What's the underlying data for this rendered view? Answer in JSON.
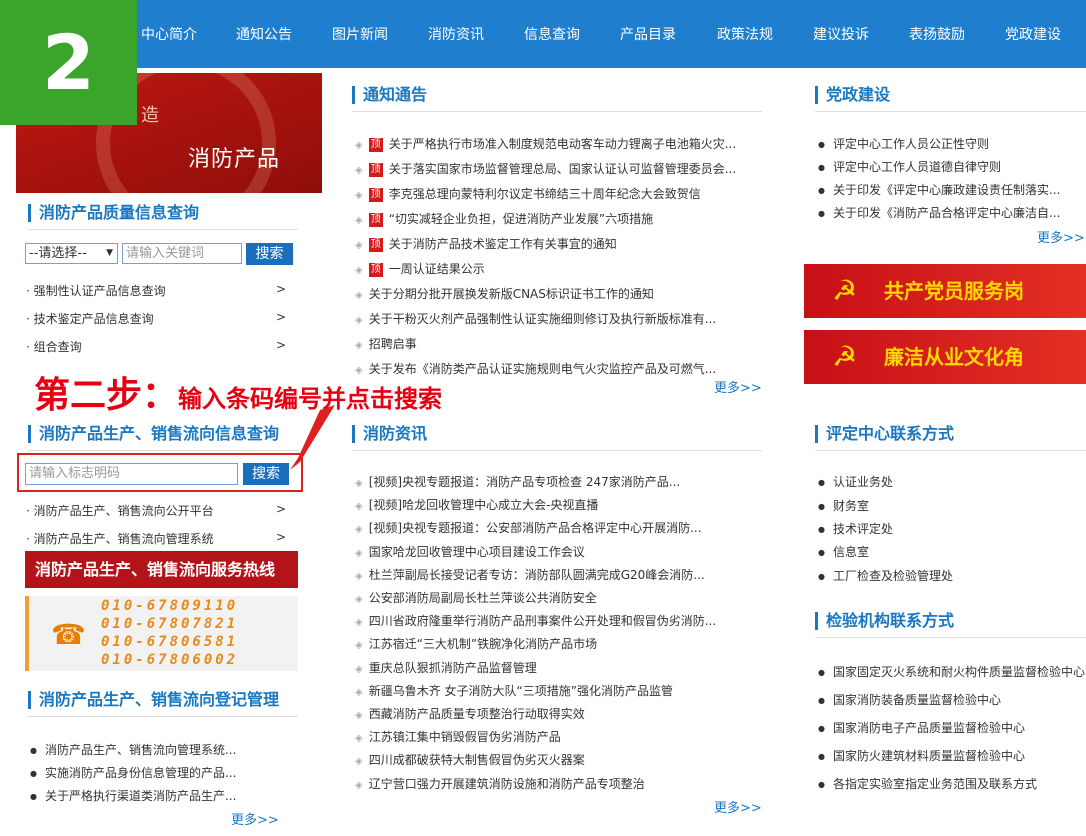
{
  "nav": [
    "中心简介",
    "通知公告",
    "图片新闻",
    "消防资讯",
    "信息查询",
    "产品目录",
    "政策法规",
    "建议投诉",
    "表扬鼓励",
    "党政建设"
  ],
  "step_badge": "2",
  "banner": {
    "text": "消防产品",
    "partial": "造"
  },
  "quality": {
    "title": "消防产品质量信息查询",
    "select_value": "--请选择--",
    "keyword_placeholder": "请输入关键词",
    "search_label": "搜索",
    "links": [
      "强制性认证产品信息查询",
      "技术鉴定产品信息查询",
      "组合查询"
    ]
  },
  "step2": {
    "big": "第二步：",
    "small": "输入条码编号并点击搜索"
  },
  "flow": {
    "title": "消防产品生产、销售流向信息查询",
    "input_placeholder": "请输入标志明码",
    "search_label": "搜索",
    "links": [
      "消防产品生产、销售流向公开平台",
      "消防产品生产、销售流向管理系统"
    ]
  },
  "hotline": {
    "title": "消防产品生产、销售流向服务热线",
    "numbers": [
      "010-67809110",
      "010-67807821",
      "010-67806581",
      "010-67806002"
    ]
  },
  "register": {
    "title": "消防产品生产、销售流向登记管理",
    "items": [
      "消防产品生产、销售流向管理系统...",
      "实施消防产品身份信息管理的产品...",
      "关于严格执行渠道类消防产品生产..."
    ],
    "more": "更多>>"
  },
  "notice": {
    "title": "通知通告",
    "top_label": "顶",
    "items": [
      {
        "text": "关于严格执行市场准入制度规范电动客车动力锂离子电池箱火灾...",
        "top": true
      },
      {
        "text": "关于落实国家市场监督管理总局、国家认证认可监督管理委员会...",
        "top": true
      },
      {
        "text": "李克强总理向蒙特利尔议定书缔结三十周年纪念大会致贺信",
        "top": true
      },
      {
        "text": "“切实减轻企业负担，促进消防产业发展”六项措施",
        "top": true
      },
      {
        "text": "关于消防产品技术鉴定工作有关事宜的通知",
        "top": true
      },
      {
        "text": "一周认证结果公示",
        "top": true
      },
      {
        "text": "关于分期分批开展换发新版CNAS标识证书工作的通知",
        "top": false
      },
      {
        "text": "关于干粉灭火剂产品强制性认证实施细则修订及执行新版标准有...",
        "top": false
      },
      {
        "text": "招聘启事",
        "top": false
      },
      {
        "text": "关于发布《消防类产品认证实施规则电气火灾监控产品及可燃气...",
        "top": false
      }
    ],
    "more": "更多>>"
  },
  "fire_news": {
    "title": "消防资讯",
    "items": [
      "[视频]央视专题报道：消防产品专项检查 247家消防产品...",
      "[视频]哈龙回收管理中心成立大会-央视直播",
      "[视频]央视专题报道：公安部消防产品合格评定中心开展消防...",
      "国家哈龙回收管理中心项目建设工作会议",
      "杜兰萍副局长接受记者专访：消防部队圆满完成G20峰会消防...",
      "公安部消防局副局长杜兰萍谈公共消防安全",
      "四川省政府隆重举行消防产品刑事案件公开处理和假冒伪劣消防...",
      "江苏宿迁“三大机制”铁腕净化消防产品市场",
      "重庆总队狠抓消防产品监督管理",
      "新疆乌鲁木齐 女子消防大队“三项措施”强化消防产品监管",
      "西藏消防产品质量专项整治行动取得实效",
      "江苏镇江集中销毁假冒伪劣消防产品",
      "四川成都破获特大制售假冒伪劣灭火器案",
      "辽宁营口强力开展建筑消防设施和消防产品专项整治"
    ],
    "more": "更多>>"
  },
  "party": {
    "title": "党政建设",
    "items": [
      "评定中心工作人员公正性守则",
      "评定中心工作人员道德自律守则",
      "关于印发《评定中心廉政建设责任制落实...",
      "关于印发《消防产品合格评定中心廉洁自..."
    ],
    "more": "更多>>",
    "banners": [
      "共产党员服务岗",
      "廉洁从业文化角"
    ],
    "emblem": "☭"
  },
  "contact": {
    "title": "评定中心联系方式",
    "items": [
      "认证业务处",
      "财务室",
      "技术评定处",
      "信息室",
      "工厂检查及检验管理处"
    ]
  },
  "labs": {
    "title": "检验机构联系方式",
    "items": [
      "国家固定灭火系统和耐火构件质量监督检验中心",
      "国家消防装备质量监督检验中心",
      "国家消防电子产品质量监督检验中心",
      "国家防火建筑材料质量监督检验中心",
      "各指定实验室指定业务范围及联系方式"
    ]
  },
  "icons": {
    "phone": "phone-icon",
    "emblem": "party-emblem-icon"
  }
}
